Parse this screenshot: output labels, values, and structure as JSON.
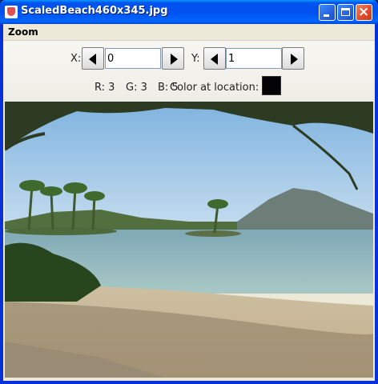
{
  "window": {
    "title": "ScaledBeach460x345.jpg"
  },
  "menu": {
    "items": [
      "Zoom"
    ]
  },
  "controls": {
    "x_label": "X:",
    "x_value": "0",
    "y_label": "Y:",
    "y_value": "1"
  },
  "info": {
    "r_label": "R: 3",
    "g_label": "G: 3",
    "b_label": "B: 5",
    "color_label": "Color at location:",
    "color_swatch": "#030305"
  },
  "image": {
    "subject": "beach"
  }
}
